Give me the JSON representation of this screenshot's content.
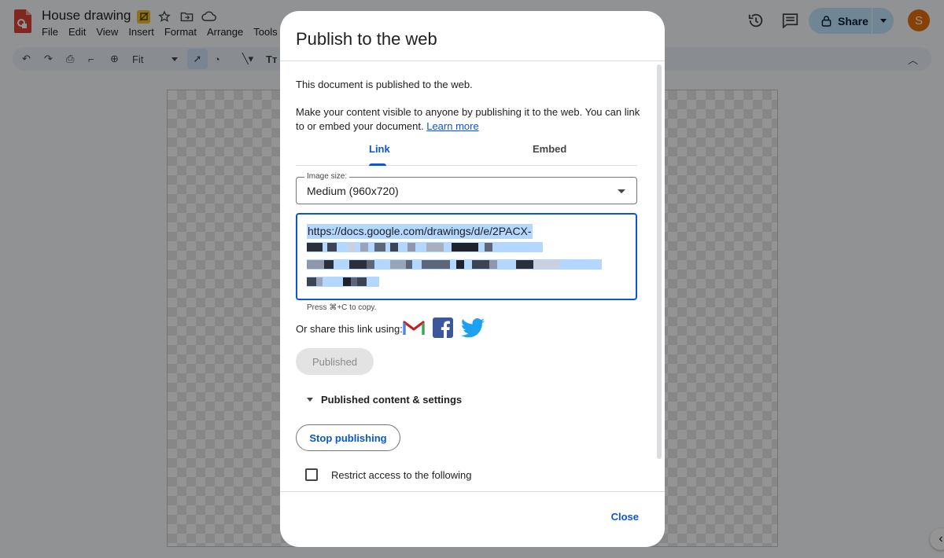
{
  "app": {
    "doc_title": "House drawing",
    "menu": [
      "File",
      "Edit",
      "View",
      "Insert",
      "Format",
      "Arrange",
      "Tools"
    ],
    "zoom": "Fit",
    "share_label": "Share",
    "avatar_letter": "S",
    "text_tool": "Tт"
  },
  "dialog": {
    "title": "Publish to the web",
    "status": "This document is published to the web.",
    "description": "Make your content visible to anyone by publishing it to the web. You can link to or embed your document.",
    "learn_more": "Learn more",
    "tabs": [
      "Link",
      "Embed"
    ],
    "image_size_label": "Image size:",
    "image_size_value": "Medium (960x720)",
    "url_visible": "https://docs.google.com/drawings/d/e/2PACX-",
    "copy_hint": "Press ⌘+C to copy.",
    "share_using": "Or share this link using:",
    "published_button": "Published",
    "published_settings": "Published content & settings",
    "stop_publishing": "Stop publishing",
    "restrict_label": "Restrict access to the following",
    "close": "Close"
  },
  "colors": {
    "accent": "#0b57d0",
    "share_bg": "#c2e7ff",
    "avatar": "#e8710a"
  },
  "icons": [
    "drawings-logo-icon",
    "star-icon",
    "move-folder-icon",
    "cloud-icon",
    "history-icon",
    "comment-icon",
    "lock-icon",
    "gmail-icon",
    "facebook-icon",
    "twitter-icon"
  ]
}
